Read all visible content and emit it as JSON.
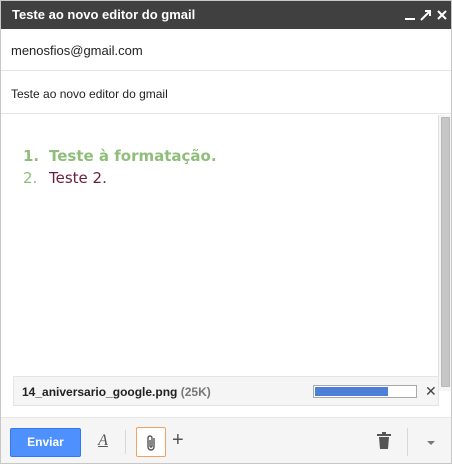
{
  "window": {
    "title": "Teste ao novo editor do gmail",
    "controls": [
      "minimize-icon",
      "expand-icon",
      "close-icon"
    ]
  },
  "to": {
    "value": "menosfios@gmail.com"
  },
  "subject": {
    "value": "Teste ao novo editor do gmail"
  },
  "body": {
    "list": [
      {
        "number": "1.",
        "text": "Teste à formatação.",
        "color": "#8fbe7a"
      },
      {
        "number": "2.",
        "text": "Teste 2.",
        "color": "#6b1f3d"
      }
    ]
  },
  "attachment": {
    "filename": "14_aniversario_google.png",
    "size": "(25K)",
    "upload_progress": 0.73
  },
  "toolbar": {
    "send_label": "Enviar",
    "format_icon": "text-format-icon",
    "attach_icon": "paperclip-icon",
    "more_icon": "plus-icon",
    "discard_icon": "trash-icon",
    "options_icon": "chevron-down-icon"
  },
  "colors": {
    "titlebar": "#404040",
    "send": "#4d90fe",
    "progress": "#4d7fd6"
  }
}
